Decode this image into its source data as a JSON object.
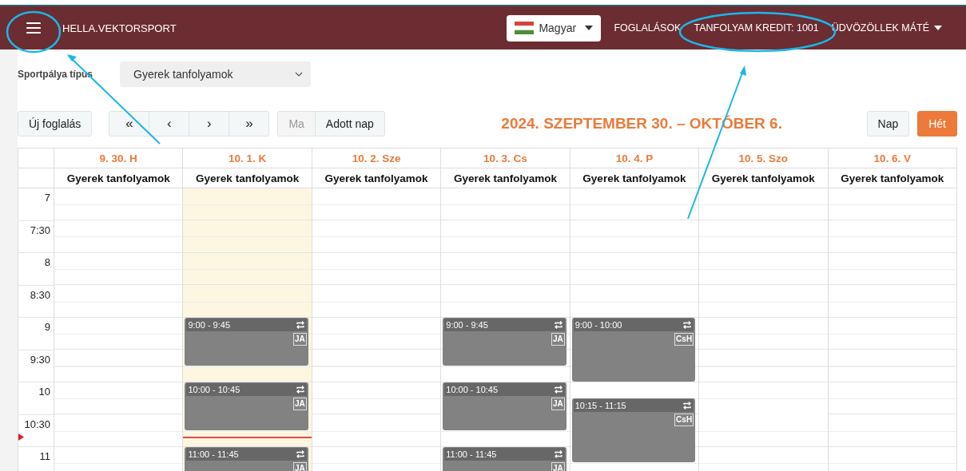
{
  "header": {
    "brand": "HELLA.VEKTORSPORT",
    "language": "Magyar",
    "links": [
      "FOGLALÁSOK",
      "TANFOLYAM KREDIT: 1001"
    ],
    "user": "ÜDVÖZÖLLEK MÁTÉ"
  },
  "filter": {
    "label": "Sportpálya típus",
    "value": "Gyerek tanfolyamok"
  },
  "toolbar": {
    "new_booking": "Új foglalás",
    "nav": [
      "«",
      "‹",
      "›",
      "»"
    ],
    "day_buttons": [
      {
        "label": "Ma",
        "disabled": true
      },
      {
        "label": "Adott nap",
        "disabled": false
      }
    ],
    "range_title": "2024. SZEPTEMBER 30. – OKTÓBER 6.",
    "views": [
      {
        "label": "Nap",
        "selected": false
      },
      {
        "label": "Hét",
        "selected": true
      }
    ]
  },
  "days": [
    {
      "date": "9. 30. H",
      "resource": "Gyerek tanfolyamok",
      "today": false
    },
    {
      "date": "10. 1. K",
      "resource": "Gyerek tanfolyamok",
      "today": true,
      "events": [
        {
          "time": "9:00 - 9:45",
          "tag": "JA"
        },
        {
          "time": "10:00 - 10:45",
          "tag": "JA"
        },
        {
          "time": "11:00 - 11:45",
          "tag": "JA"
        }
      ]
    },
    {
      "date": "10. 2. Sze",
      "resource": "Gyerek tanfolyamok",
      "today": false
    },
    {
      "date": "10. 3. Cs",
      "resource": "Gyerek tanfolyamok",
      "today": false,
      "events": [
        {
          "time": "9:00 - 9:45",
          "tag": "JA"
        },
        {
          "time": "10:00 - 10:45",
          "tag": "JA"
        },
        {
          "time": "11:00 - 11:45",
          "tag": "JA"
        }
      ]
    },
    {
      "date": "10. 4. P",
      "resource": "Gyerek tanfolyamok",
      "today": false,
      "events": [
        {
          "time": "9:00 - 10:00",
          "tag": "CsH"
        },
        {
          "time": "10:15 - 11:15",
          "tag": "CsH"
        }
      ]
    },
    {
      "date": "10. 5. Szo",
      "resource": "Gyerek tanfolyamok",
      "today": false
    },
    {
      "date": "10. 6. V",
      "resource": "Gyerek tanfolyamok",
      "today": false
    }
  ],
  "time_slots": [
    "7",
    "7:30",
    "8",
    "8:30",
    "9",
    "9:30",
    "10",
    "10:30",
    "11"
  ]
}
